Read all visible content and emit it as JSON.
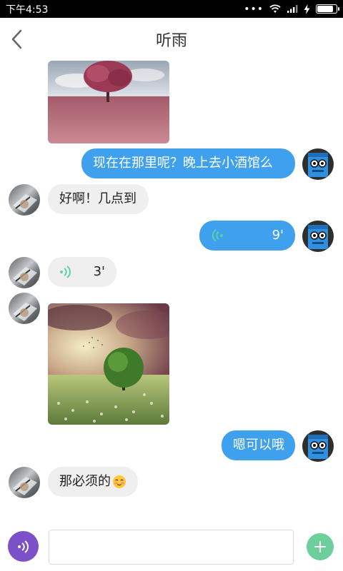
{
  "status_bar": {
    "time": "下午4:53",
    "signal_dots": "•••"
  },
  "header": {
    "title": "听雨"
  },
  "messages": [
    {
      "side": "in",
      "type": "image",
      "image": "pink-tree-field"
    },
    {
      "side": "out",
      "type": "text",
      "text": "现在在那里呢？晚上去小酒馆么"
    },
    {
      "side": "in",
      "type": "text",
      "text": "好啊！几点到"
    },
    {
      "side": "out",
      "type": "voice",
      "duration": "9'"
    },
    {
      "side": "in",
      "type": "voice",
      "duration": "3'"
    },
    {
      "side": "in",
      "type": "image",
      "image": "green-tree-meadow"
    },
    {
      "side": "out",
      "type": "text",
      "text": "嗯可以哦"
    },
    {
      "side": "in",
      "type": "text",
      "text": "那必须的",
      "emoji": "blushing-face-emoji"
    }
  ],
  "colors": {
    "outgoing_bubble": "#3fa0ee",
    "incoming_bubble": "#efefef",
    "voice_wave": "#5cd3a0",
    "mic_button": "#7b50c8",
    "plus_button": "#6dd09c"
  }
}
